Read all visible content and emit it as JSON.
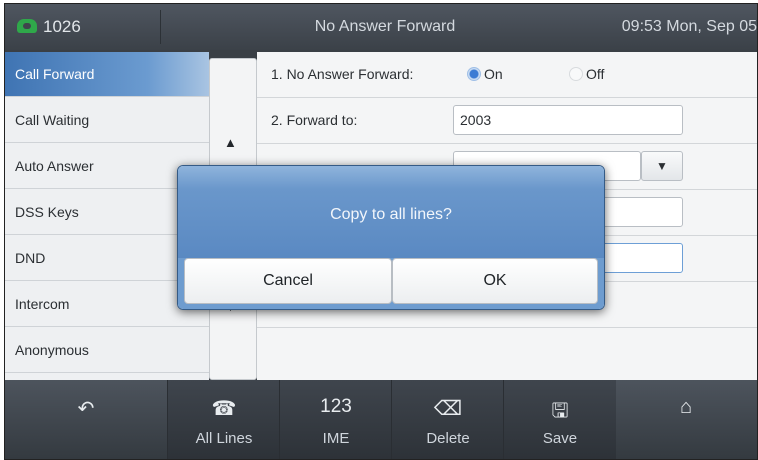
{
  "topbar": {
    "line_icon": "phone-icon",
    "line": "1026",
    "title": "No Answer Forward",
    "datetime": "09:53 Mon, Sep 05"
  },
  "menu": {
    "items": [
      {
        "label": "Call Forward"
      },
      {
        "label": "Call Waiting"
      },
      {
        "label": "Auto Answer"
      },
      {
        "label": "DSS Keys"
      },
      {
        "label": "DND"
      },
      {
        "label": "Intercom"
      },
      {
        "label": "Anonymous"
      }
    ],
    "active_index": 0
  },
  "scroll": {
    "up": "▲",
    "down": "▼"
  },
  "form": {
    "row1_label": "1. No Answer Forward:",
    "on_label": "On",
    "off_label": "Off",
    "selected": "On",
    "row2_label": "2. Forward to:",
    "forward_to": "2003",
    "dropdown_arrow": "▼"
  },
  "softkeys": [
    {
      "icon": "back-icon",
      "label": ""
    },
    {
      "icon": "phone-icon",
      "label": "All Lines"
    },
    {
      "icon": "123",
      "label": "IME"
    },
    {
      "icon": "backspace-icon",
      "label": "Delete"
    },
    {
      "icon": "save-icon",
      "label": "Save"
    },
    {
      "icon": "home-icon",
      "label": ""
    }
  ],
  "dialog": {
    "message": "Copy to all lines?",
    "cancel_label": "Cancel",
    "ok_label": "OK"
  },
  "colors": {
    "accent": "#3f74b3",
    "dialog_blue": "#6a97cb",
    "radio_on": "#3b7bd4"
  }
}
